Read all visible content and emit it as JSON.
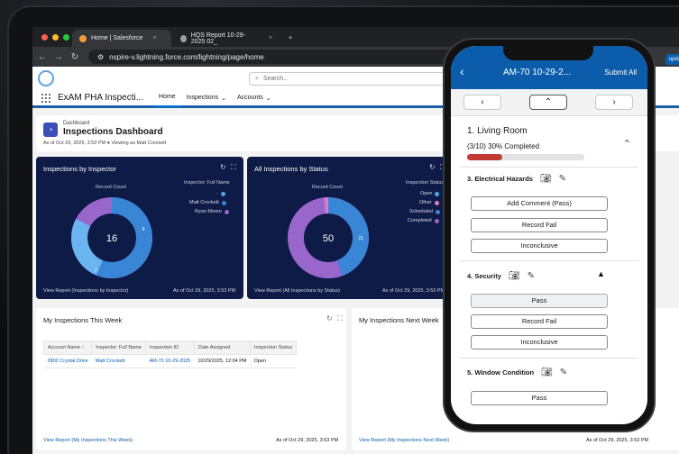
{
  "browser": {
    "tabs": [
      {
        "label": "Home | Salesforce",
        "active": true
      },
      {
        "label": "HQS Report 10-29-2025 02_",
        "active": false
      }
    ],
    "new_tab": "+",
    "url": "nspire-v.lightning.force.com/lightning/page/home"
  },
  "header": {
    "search_placeholder": "Search...",
    "app_name": "ExAM PHA Inspecti...",
    "nav": [
      "Home",
      "Inspections",
      "Accounts"
    ]
  },
  "dashboard": {
    "eyebrow": "Dashboard",
    "title": "Inspections Dashboard",
    "subtitle": "As of Oct 29, 2025, 3:53 PM",
    "viewing": "Viewing as Matt Crockett"
  },
  "panel1": {
    "title": "Inspections by Inspector",
    "record_count_label": "Record Count",
    "legend_title": "Inspector: Full Name",
    "legend": [
      {
        "label": "-",
        "color": "#4fa3e8"
      },
      {
        "label": "Matt Crockett",
        "color": "#3a86d6"
      },
      {
        "label": "Ryan Moore",
        "color": "#9966cc"
      }
    ],
    "total": "16",
    "slice_labels": [
      "9",
      "7"
    ],
    "footer_link": "View Report (Inspections by Inspector)",
    "footer_time": "As of Oct 29, 2025, 3:53 PM"
  },
  "panel2": {
    "title": "All Inspections by Status",
    "record_count_label": "Record Count",
    "legend_title": "Inspection Status",
    "legend": [
      {
        "label": "Open",
        "color": "#4fa3e8"
      },
      {
        "label": "Other",
        "color": "#e07ac0"
      },
      {
        "label": "Scheduled",
        "color": "#3a86d6"
      },
      {
        "label": "Completed",
        "color": "#9966cc"
      }
    ],
    "total": "50",
    "slice_labels": [
      "21"
    ],
    "footer_link": "View Report (All Inspections by Status)",
    "footer_time": "As of Oct 29, 2025, 3:53 PM"
  },
  "panel3": {
    "title": "My Inspections This Week",
    "columns": [
      "Account Name ↑",
      "Inspector: Full Name",
      "Inspection ID",
      "Date Assigned",
      "Inspection Status"
    ],
    "rows": [
      [
        "2800 Crystal Drive",
        "Matt Crockett",
        "AM-70 10-29-2025",
        "10/29/2025, 12:04 PM",
        "Open"
      ]
    ],
    "footer_link": "View Report (My Inspections This Week)",
    "footer_time": "As of Oct 29, 2025, 3:53 PM"
  },
  "panel4": {
    "title": "My Inspections Next Week",
    "footer_link": "View Report (My Inspections Next Week)",
    "footer_time": "As of Oct 29, 2025, 3:53 PM"
  },
  "mobile": {
    "title": "AM-70 10-29-2...",
    "submit": "Submit All",
    "update_label": "update",
    "section_title": "1. Living Room",
    "progress_text": "(3/10)  30% Completed",
    "progress": 0.3,
    "questions": [
      {
        "label": "3. Electrical Hazards",
        "options": [
          "Add Comment (Pass)",
          "Record Fail",
          "Inconclusive"
        ]
      },
      {
        "label": "4. Security",
        "options": [
          "Pass",
          "Record Fail",
          "Inconclusive"
        ]
      },
      {
        "label": "5. Window Condition",
        "options": [
          "Pass"
        ]
      }
    ]
  },
  "colors": {
    "brand": "#0b5cab",
    "dash_panel": "#0d1b46",
    "progress": "#c23934"
  }
}
